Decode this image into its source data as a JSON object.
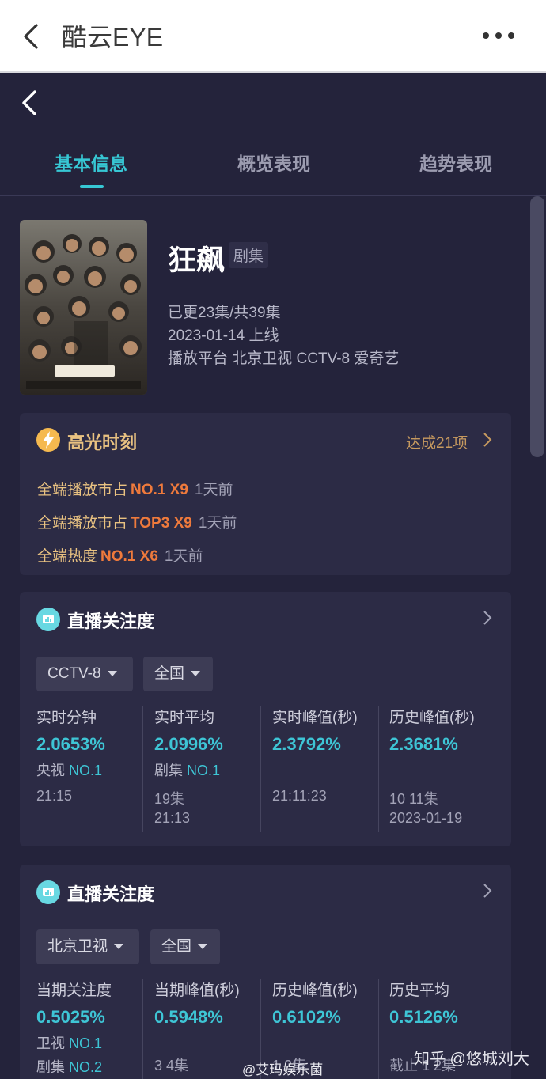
{
  "app": {
    "title": "酷云EYE"
  },
  "icons": {
    "back": "back-arrow-icon",
    "more": "more-dots-icon",
    "highlight": "lightning-icon",
    "live": "chart-bubble-icon",
    "chevron": "chevron-right-icon"
  },
  "tabs": [
    "基本信息",
    "概览表现",
    "趋势表现"
  ],
  "show": {
    "name": "狂飙",
    "tag": "剧集",
    "episodes": "已更23集/共39集",
    "release": "2023-01-14 上线",
    "platforms": "播放平台 北京卫视 CCTV-8 爱奇艺"
  },
  "highlights": {
    "title": "高光时刻",
    "count": "达成21项",
    "items": [
      {
        "label": "全端播放市占",
        "rank": "NO.1 X9",
        "ago": "1天前"
      },
      {
        "label": "全端播放市占",
        "rank": "TOP3 X9",
        "ago": "1天前"
      },
      {
        "label": "全端热度",
        "rank": "NO.1 X6",
        "ago": "1天前"
      }
    ]
  },
  "live1": {
    "title": "直播关注度",
    "filters": [
      "CCTV-8",
      "全国"
    ],
    "cols": [
      {
        "k": "实时分钟",
        "v": "2.0653%",
        "rk_pre": "央视",
        "rk": "NO.1",
        "rk2_pre": "",
        "rk2": "",
        "sub": [
          "21:15",
          ""
        ]
      },
      {
        "k": "实时平均",
        "v": "2.0996%",
        "rk_pre": "剧集",
        "rk": "NO.1",
        "rk2_pre": "",
        "rk2": "",
        "sub": [
          "19集",
          "21:13"
        ]
      },
      {
        "k": "实时峰值(秒)",
        "v": "2.3792%",
        "rk_pre": "",
        "rk": "",
        "rk2_pre": "",
        "rk2": "",
        "sub": [
          "21:11:23",
          ""
        ]
      },
      {
        "k": "历史峰值(秒)",
        "v": "2.3681%",
        "rk_pre": "",
        "rk": "",
        "rk2_pre": "",
        "rk2": "",
        "sub": [
          "10 11集",
          "2023-01-19"
        ]
      }
    ]
  },
  "live2": {
    "title": "直播关注度",
    "filters": [
      "北京卫视",
      "全国"
    ],
    "cols": [
      {
        "k": "当期关注度",
        "v": "0.5025%",
        "rk_pre": "卫视",
        "rk": "NO.1",
        "rk2_pre": "剧集",
        "rk2": "NO.2",
        "sub": [
          "",
          ""
        ]
      },
      {
        "k": "当期峰值(秒)",
        "v": "0.5948%",
        "rk_pre": "",
        "rk": "",
        "rk2_pre": "",
        "rk2": "",
        "sub": [
          "3 4集",
          ""
        ]
      },
      {
        "k": "历史峰值(秒)",
        "v": "0.6102%",
        "rk_pre": "",
        "rk": "",
        "rk2_pre": "",
        "rk2": "",
        "sub": [
          "1 2集",
          ""
        ]
      },
      {
        "k": "历史平均",
        "v": "0.5126%",
        "rk_pre": "",
        "rk": "",
        "rk2_pre": "",
        "rk2": "",
        "sub": [
          "截止 1 2集",
          ""
        ]
      }
    ]
  },
  "watermarks": {
    "weibo": "@艾玛娱乐菌",
    "zhihu": "知乎 @悠城刘大"
  },
  "colors": {
    "accent": "#37c7d4",
    "gold": "#e9c281",
    "orange": "#ef7a3c",
    "bg": "#24233b",
    "card": "#2c2b45"
  }
}
